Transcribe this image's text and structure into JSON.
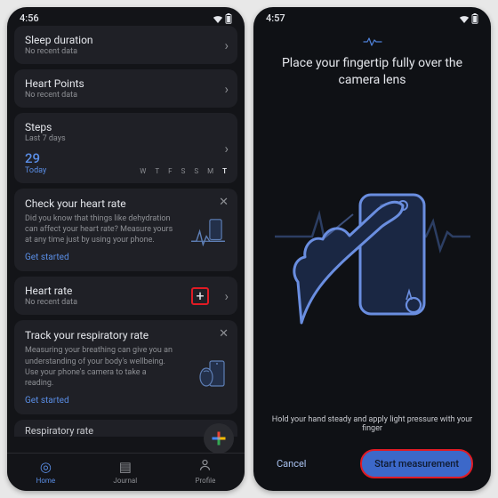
{
  "phone1": {
    "time": "4:56",
    "cards": {
      "sleep": {
        "title": "Sleep duration",
        "sub": "No recent data"
      },
      "hp": {
        "title": "Heart Points",
        "sub": "No recent data"
      },
      "steps": {
        "title": "Steps",
        "sub": "Last 7 days",
        "value": "29",
        "today": "Today",
        "days": [
          "W",
          "T",
          "F",
          "S",
          "S",
          "M",
          "T"
        ]
      },
      "hr_tip": {
        "title": "Check your heart rate",
        "body": "Did you know that things like dehydration can affect your heart rate? Measure yours at any time just by using your phone.",
        "link": "Get started"
      },
      "hr": {
        "title": "Heart rate",
        "sub": "No recent data"
      },
      "resp_tip": {
        "title": "Track your respiratory rate",
        "body": "Measuring your breathing can give you an understanding of your body's wellbeing. Use your phone's camera to take a reading.",
        "link": "Get started"
      },
      "resp": {
        "title": "Respiratory rate"
      }
    },
    "nav": {
      "home": "Home",
      "journal": "Journal",
      "profile": "Profile"
    }
  },
  "phone2": {
    "time": "4:57",
    "title": "Place your fingertip fully over the camera lens",
    "hint": "Hold your hand steady and apply light pressure with your finger",
    "cancel": "Cancel",
    "start": "Start measurement"
  }
}
